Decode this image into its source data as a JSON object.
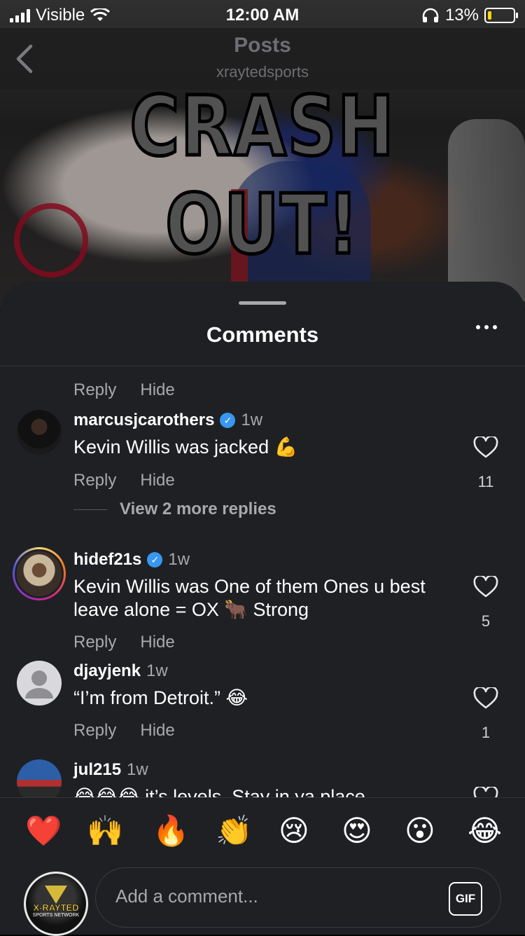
{
  "status_bar": {
    "carrier": "Visible",
    "time": "12:00 AM",
    "battery": "13%"
  },
  "nav": {
    "title": "Posts",
    "subtitle": "xraytedsports"
  },
  "post": {
    "image_text": "CRASH OUT!"
  },
  "sheet": {
    "title": "Comments"
  },
  "top_actions": {
    "reply": "Reply",
    "hide": "Hide"
  },
  "comments": [
    {
      "username": "marcusjcarothers",
      "age": "1w",
      "text": "Kevin Willis was jacked 💪",
      "reply": "Reply",
      "hide": "Hide",
      "likes": "11",
      "view_more": "View 2 more replies"
    },
    {
      "username": "hidef21s",
      "age": "1w",
      "text": "Kevin Willis was One of them Ones u best leave alone = OX 🐂 Strong",
      "reply": "Reply",
      "hide": "Hide",
      "likes": "5"
    },
    {
      "username": "djayjenk",
      "age": "1w",
      "text": "“I’m from Detroit.” 😂",
      "reply": "Reply",
      "hide": "Hide",
      "likes": "1"
    },
    {
      "username": "jul215",
      "age": "1w",
      "text": "😂😂😂 it’s levels. Stay in ya place"
    }
  ],
  "reactions": [
    "❤️",
    "🙌",
    "🔥",
    "👏",
    "😢",
    "😍",
    "😮",
    "😂"
  ],
  "composer": {
    "placeholder": "Add a comment...",
    "gif_label": "GIF",
    "avatar_text": "X-RAYTED",
    "avatar_subtext": "SPORTS NETWORK"
  },
  "colors": {
    "sheet_bg": "#1f2024",
    "accent_verified": "#3897f0",
    "muted_text": "#a8a8ad",
    "like_red": "#ff3040"
  }
}
